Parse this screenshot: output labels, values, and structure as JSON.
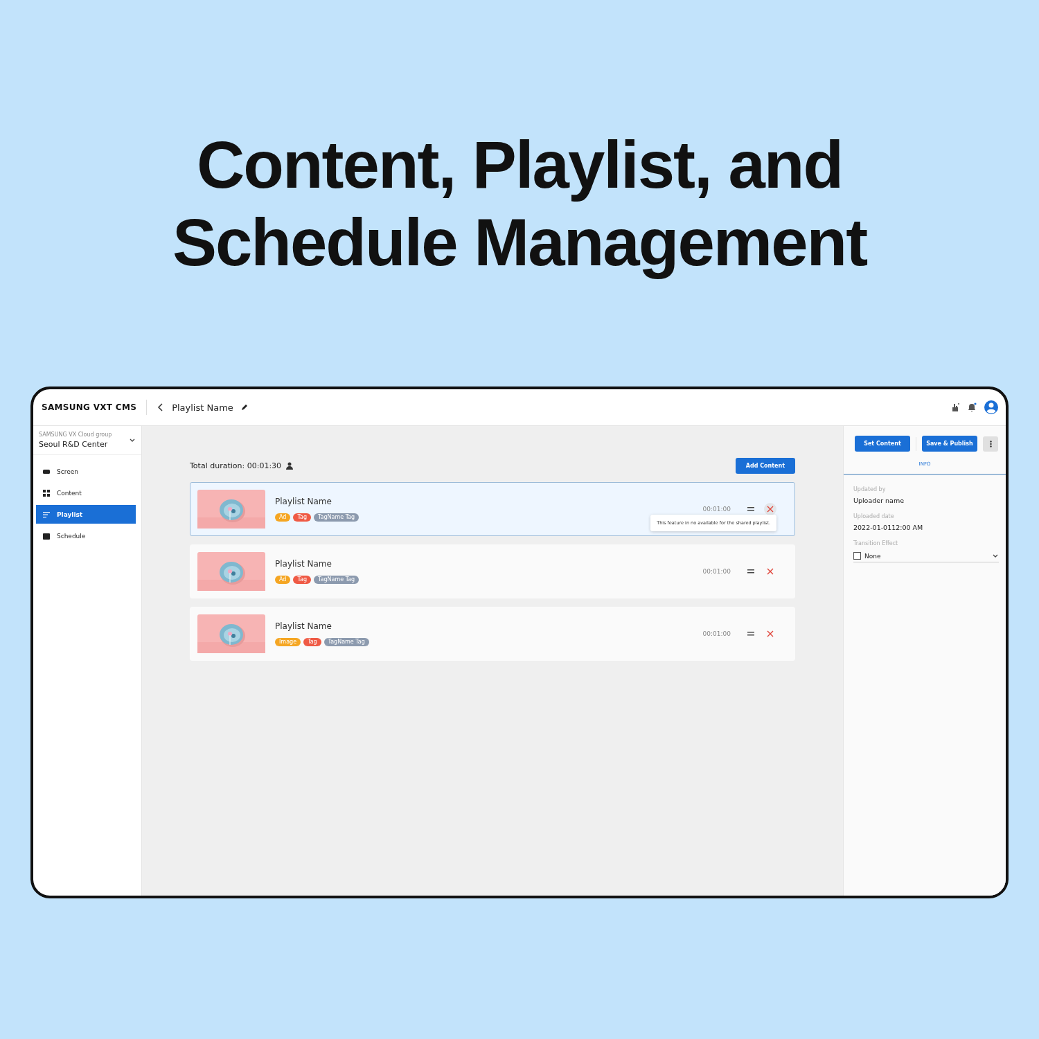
{
  "headline": "Content, Playlist, and Schedule Management",
  "app": {
    "brand": "SAMSUNG VXT CMS",
    "page_title": "Playlist Name",
    "sidebar": {
      "group_label": "SAMSUNG VX Cloud group",
      "group_name": "Seoul R&D Center",
      "items": [
        {
          "label": "Screen",
          "selected": false
        },
        {
          "label": "Content",
          "selected": false
        },
        {
          "label": "Playlist",
          "selected": true
        },
        {
          "label": "Schedule",
          "selected": false
        }
      ]
    },
    "main": {
      "total_duration": "Total duration: 00:01:30",
      "add_button": "Add Content",
      "items": [
        {
          "name": "Playlist Name",
          "duration": "00:01:00",
          "selected": true,
          "tooltip": "This feature in no available for the shared playlist.",
          "tags": [
            {
              "label": "Ad",
              "color": "#f5a623"
            },
            {
              "label": "Tag",
              "color": "#ef5a45"
            },
            {
              "label": "TagName Tag",
              "color": "#8c9aae"
            }
          ]
        },
        {
          "name": "Playlist Name",
          "duration": "00:01:00",
          "selected": false,
          "tags": [
            {
              "label": "Ad",
              "color": "#f5a623"
            },
            {
              "label": "Tag",
              "color": "#ef5a45"
            },
            {
              "label": "TagName Tag",
              "color": "#8c9aae"
            }
          ]
        },
        {
          "name": "Playlist Name",
          "duration": "00:01:00",
          "selected": false,
          "tags": [
            {
              "label": "Image",
              "color": "#f5a623"
            },
            {
              "label": "Tag",
              "color": "#ef5a45"
            },
            {
              "label": "TagName Tag",
              "color": "#8c9aae"
            }
          ]
        }
      ]
    },
    "panel": {
      "buttons": [
        "Set Content",
        "Save & Publish"
      ],
      "tabs": [
        {
          "label": "INFO",
          "selected": true
        }
      ],
      "fields": [
        {
          "label": "Updated by",
          "value": "Uploader name"
        },
        {
          "label": "Uploaded date",
          "value": "2022-01-0112:00 AM"
        }
      ],
      "transition": {
        "label": "Transition Effect",
        "value": "None",
        "checked": false
      }
    }
  }
}
